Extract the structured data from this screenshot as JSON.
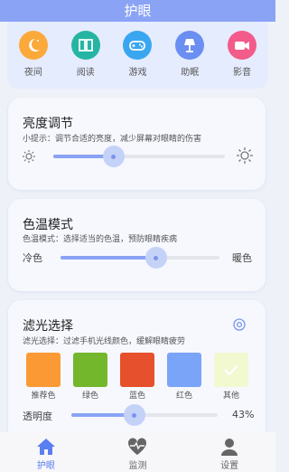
{
  "header": {
    "title": "护眼"
  },
  "modes": [
    {
      "label": "夜间",
      "icon": "moon-icon",
      "color": "#fba93a"
    },
    {
      "label": "阅读",
      "icon": "book-icon",
      "color": "#26b5a3"
    },
    {
      "label": "游戏",
      "icon": "gamepad-icon",
      "color": "#3aa6f0"
    },
    {
      "label": "助眠",
      "icon": "lamp-icon",
      "color": "#6b8ef2"
    },
    {
      "label": "影音",
      "icon": "video-icon",
      "color": "#f25b8a"
    }
  ],
  "brightness": {
    "title": "亮度调节",
    "tip": "小提示：调节合适的亮度，减少屏幕对眼睛的伤害",
    "level": 0.35
  },
  "color_temp": {
    "title": "色温模式",
    "tip": "色温模式：选择适当的色温，预防眼睛疾病",
    "left_label": "冷色",
    "right_label": "暖色",
    "level": 0.6
  },
  "filter": {
    "title": "滤光选择",
    "tip": "滤光选择：过滤手机光线颜色，缓解眼睛疲劳",
    "swatches": [
      {
        "label": "推荐色",
        "color": "#fb9a35",
        "selected": false
      },
      {
        "label": "绿色",
        "color": "#73b72c",
        "selected": false
      },
      {
        "label": "蓝色",
        "color": "#e6502c",
        "selected": false
      },
      {
        "label": "红色",
        "color": "#7aa4f7",
        "selected": false
      },
      {
        "label": "其他",
        "color": "#f2f8cf",
        "selected": true
      }
    ],
    "opacity_label": "透明度",
    "opacity_value": "43%",
    "opacity_level": 0.43
  },
  "tabs": [
    {
      "label": "护眼",
      "icon": "home-icon",
      "active": true
    },
    {
      "label": "监测",
      "icon": "heartbeat-icon",
      "active": false
    },
    {
      "label": "设置",
      "icon": "user-icon",
      "active": false
    }
  ],
  "colors": {
    "accent": "#8aa3f5",
    "active_tab": "#5b7ef0"
  }
}
